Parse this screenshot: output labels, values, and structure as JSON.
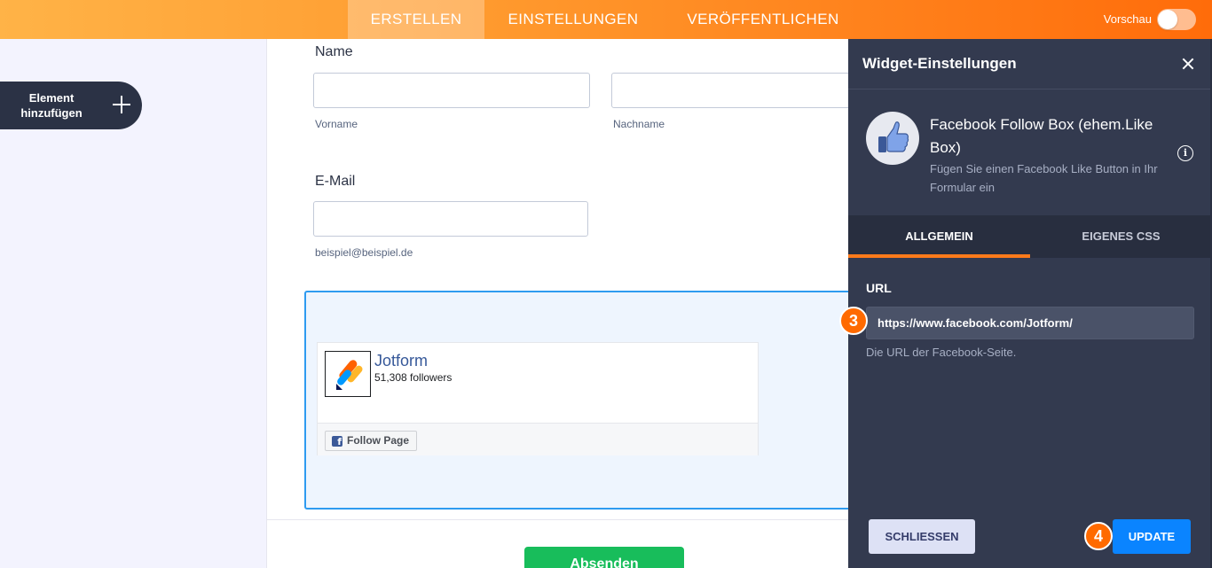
{
  "topbar": {
    "tabs": [
      {
        "label": "ERSTELLEN",
        "active": true
      },
      {
        "label": "EINSTELLUNGEN",
        "active": false
      },
      {
        "label": "VERÖFFENTLICHEN",
        "active": false
      }
    ],
    "preview_label": "Vorschau",
    "preview_enabled": false
  },
  "sidebar": {
    "add_element_label": "Element hinzufügen"
  },
  "form": {
    "name_label": "Name",
    "first_name_value": "",
    "first_name_sublabel": "Vorname",
    "last_name_value": "",
    "last_name_sublabel": "Nachname",
    "email_label": "E-Mail",
    "email_value": "",
    "email_sublabel": "beispiel@beispiel.de",
    "facebook_widget": {
      "page_name": "Jotform",
      "followers": "51,308 followers",
      "follow_button": "Follow Page"
    },
    "submit_label": "Absenden"
  },
  "panel": {
    "title": "Widget-Einstellungen",
    "widget_name": "Facebook Follow Box (ehem.Like Box)",
    "widget_description": "Fügen Sie einen Facebook Like Button in Ihr Formular ein",
    "tabs": [
      {
        "label": "ALLGEMEIN",
        "active": true
      },
      {
        "label": "EIGENES CSS",
        "active": false
      }
    ],
    "url_label": "URL",
    "url_value": "https://www.facebook.com/Jotform/",
    "url_hint": "Die URL der Facebook-Seite.",
    "close_button": "SCHLIESSEN",
    "update_button": "UPDATE",
    "step_badges": [
      "3",
      "4"
    ]
  },
  "colors": {
    "accent_orange": "#ff7a1a",
    "panel_bg": "#333a4f",
    "update_blue": "#0a84ff",
    "submit_green": "#18bd5b",
    "widget_border": "#2e9bf0"
  }
}
